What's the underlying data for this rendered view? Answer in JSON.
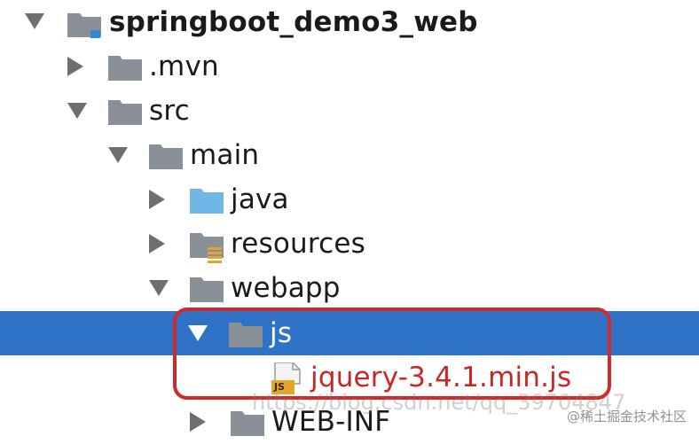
{
  "tree": {
    "root": {
      "label": "springboot_demo3_web",
      "expanded": true,
      "icon": "module-folder-icon"
    },
    "items": [
      {
        "label": ".mvn",
        "expanded": false,
        "icon": "folder-icon"
      },
      {
        "label": "src",
        "expanded": true,
        "icon": "folder-icon"
      },
      {
        "label": "main",
        "expanded": true,
        "icon": "folder-icon"
      },
      {
        "label": "java",
        "expanded": false,
        "icon": "source-folder-icon"
      },
      {
        "label": "resources",
        "expanded": false,
        "icon": "resources-folder-icon"
      },
      {
        "label": "webapp",
        "expanded": true,
        "icon": "folder-icon"
      },
      {
        "label": "js",
        "expanded": true,
        "selected": true,
        "icon": "folder-icon"
      },
      {
        "label": "jquery-3.4.1.min.js",
        "icon": "js-file-icon",
        "badge": "JS"
      },
      {
        "label": "WEB-INF",
        "expanded": false,
        "icon": "folder-icon"
      }
    ]
  },
  "watermark": {
    "url": "https://blog.csdn.net/qq_39704847",
    "site": "@稀土掘金技术社区"
  },
  "colors": {
    "selection": "#2f73c8",
    "highlight_border": "#d12a2a",
    "folder": "#8a9097",
    "source_folder": "#6fb7e6",
    "js_badge": "#e2a62c"
  }
}
